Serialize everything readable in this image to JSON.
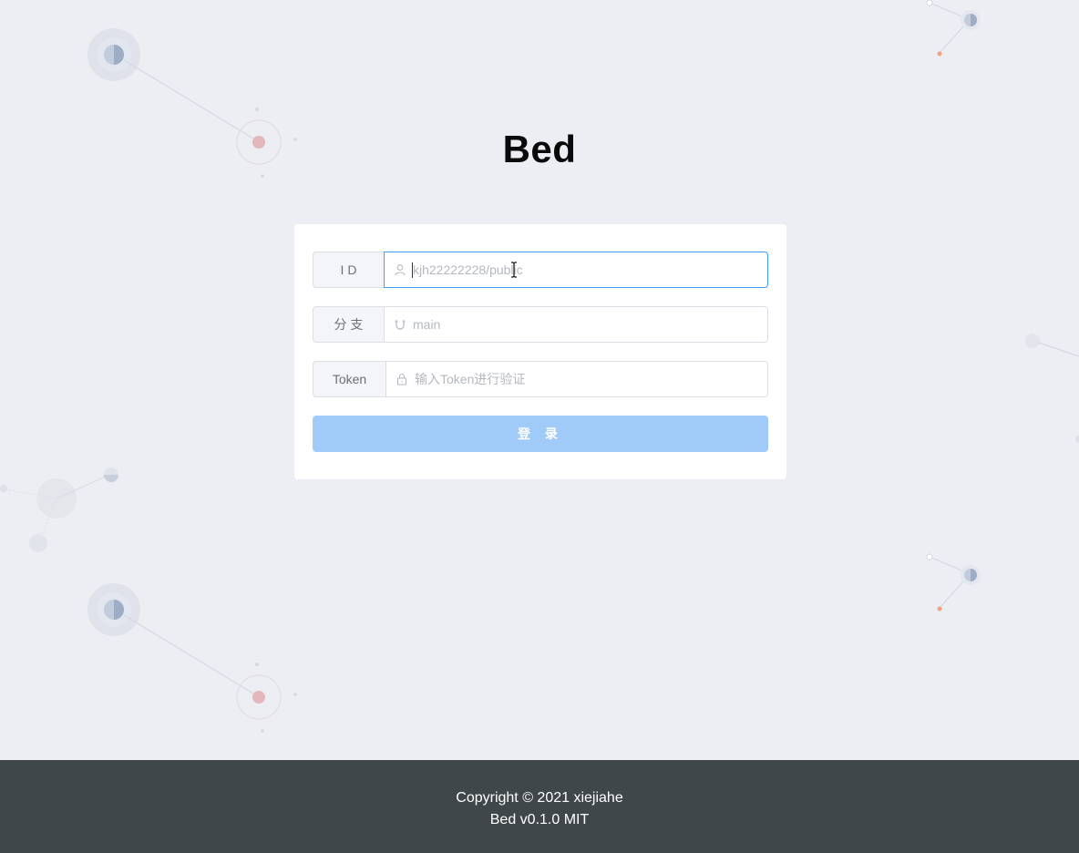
{
  "app": {
    "title": "Bed"
  },
  "form": {
    "id_label": "I D",
    "id_placeholder": "kjh22222228/public",
    "branch_label": "分 支",
    "branch_placeholder": "main",
    "token_label": "Token",
    "token_placeholder": "输入Token进行验证",
    "login_label": "登 录"
  },
  "icons": {
    "id": "user-icon",
    "branch": "magnet-icon",
    "token": "lock-icon"
  },
  "colors": {
    "primary_disabled": "#a0cbf8",
    "focus_border": "#409eff",
    "footer_bg": "#40474a",
    "page_bg": "#eceef3"
  },
  "footer": {
    "copyright": "Copyright © 2021 xiejiahe",
    "version": "Bed v0.1.0 MIT"
  }
}
